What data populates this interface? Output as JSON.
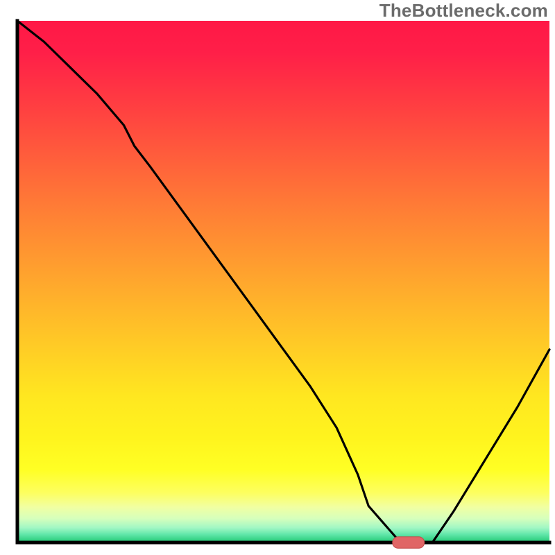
{
  "watermark": "TheBottleneck.com",
  "colors": {
    "curve": "#000000",
    "axis": "#000000",
    "marker_fill": "#e06666",
    "marker_stroke": "#c44b4b"
  },
  "chart_data": {
    "type": "line",
    "title": "",
    "xlabel": "",
    "ylabel": "",
    "xlim": [
      0,
      100
    ],
    "ylim": [
      0,
      100
    ],
    "x": [
      0,
      5,
      10,
      15,
      20,
      22,
      25,
      30,
      35,
      40,
      45,
      50,
      55,
      60,
      64,
      66,
      72,
      75,
      78,
      82,
      88,
      94,
      100
    ],
    "values": [
      100,
      96,
      91,
      86,
      80,
      76,
      72,
      65,
      58,
      51,
      44,
      37,
      30,
      22,
      13,
      7,
      0,
      0,
      0,
      6,
      16,
      26,
      37
    ],
    "marker": {
      "x": 73.5,
      "y": 0,
      "width": 6,
      "height": 2.2
    },
    "gradient_stops": [
      {
        "offset": 0.0,
        "color": "#ff1846"
      },
      {
        "offset": 0.06,
        "color": "#ff1f48"
      },
      {
        "offset": 0.15,
        "color": "#ff3a42"
      },
      {
        "offset": 0.25,
        "color": "#ff5a3c"
      },
      {
        "offset": 0.35,
        "color": "#ff7a36"
      },
      {
        "offset": 0.45,
        "color": "#ff9830"
      },
      {
        "offset": 0.55,
        "color": "#ffb62a"
      },
      {
        "offset": 0.65,
        "color": "#ffd324"
      },
      {
        "offset": 0.72,
        "color": "#ffe720"
      },
      {
        "offset": 0.8,
        "color": "#fff41e"
      },
      {
        "offset": 0.86,
        "color": "#ffff24"
      },
      {
        "offset": 0.905,
        "color": "#fdff60"
      },
      {
        "offset": 0.932,
        "color": "#f1ffa2"
      },
      {
        "offset": 0.954,
        "color": "#d6ffbc"
      },
      {
        "offset": 0.972,
        "color": "#a0f7c4"
      },
      {
        "offset": 0.985,
        "color": "#5ee6a8"
      },
      {
        "offset": 1.0,
        "color": "#21c773"
      }
    ]
  }
}
